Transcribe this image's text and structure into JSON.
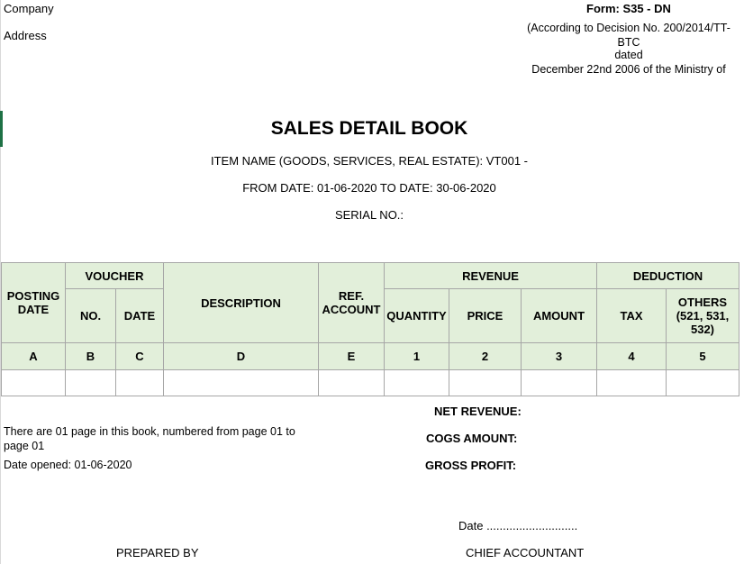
{
  "header": {
    "company_label": "Company",
    "address_label": "Address",
    "form_code": "Form: S35 - DN",
    "decision_line1": "(According to Decision No. 200/2014/TT-",
    "decision_line2": "BTC",
    "decision_line3": "dated",
    "decision_line4": "December 22nd 2006 of the Ministry of"
  },
  "title": {
    "main": "SALES DETAIL BOOK",
    "item_name": "ITEM NAME (GOODS, SERVICES, REAL ESTATE): VT001 -",
    "date_range": "FROM DATE: 01-06-2020 TO DATE: 30-06-2020",
    "serial": "SERIAL NO.:"
  },
  "table": {
    "posting_date": "POSTING DATE",
    "voucher": "VOUCHER",
    "voucher_no": "NO.",
    "voucher_date": "DATE",
    "description": "DESCRIPTION",
    "ref_account": "REF. ACCOUNT",
    "revenue": "REVENUE",
    "quantity": "QUANTITY",
    "price": "PRICE",
    "amount": "AMOUNT",
    "deduction": "DEDUCTION",
    "tax": "TAX",
    "others": "OTHERS (521, 531, 532)",
    "codes": [
      "A",
      "B",
      "C",
      "D",
      "E",
      "1",
      "2",
      "3",
      "4",
      "5"
    ]
  },
  "summary": {
    "net_revenue": "NET REVENUE:",
    "cogs_amount": "COGS AMOUNT:",
    "gross_profit": "GROSS PROFIT:"
  },
  "footer": {
    "pages_note_line1": "There are 01 page in this book, numbered from page 01 to",
    "pages_note_line2": "page 01",
    "date_opened": "Date opened:  01-06-2020",
    "date_line": "Date ............................",
    "prepared_by": "PREPARED BY",
    "chief_accountant": "CHIEF ACCOUNTANT"
  }
}
